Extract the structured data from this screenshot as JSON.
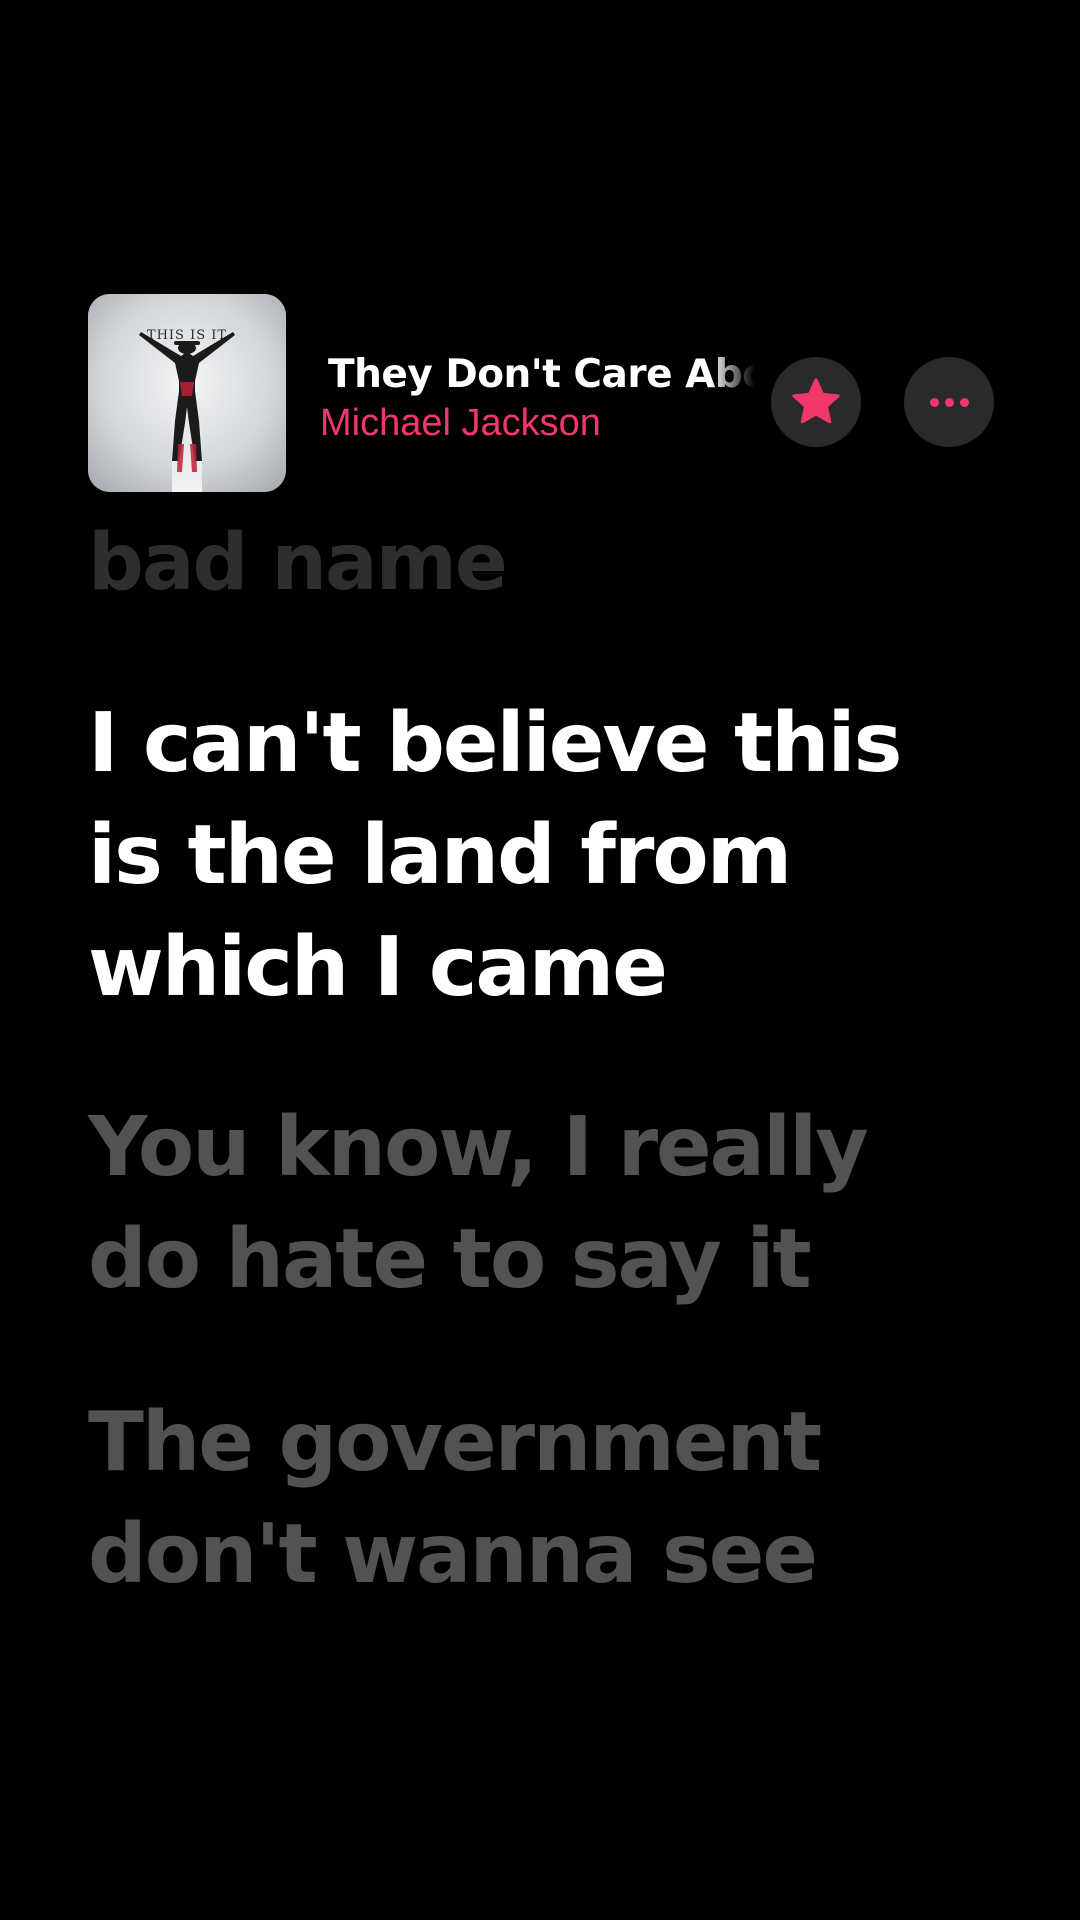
{
  "now_playing": {
    "artwork_text": "THIS IS IT",
    "title": "They Don't Care About Us",
    "artist": "Michael Jackson",
    "accent_color": "#f2376a",
    "favorite_icon": "star-icon",
    "more_icon": "ellipsis-icon"
  },
  "lyrics": {
    "previous": "bad name",
    "current": [
      "I can't believe this",
      "is the land from",
      "which I came"
    ],
    "next_1": [
      "You know, I really",
      "do hate to say it"
    ],
    "next_2": [
      "The government",
      "don't wanna see"
    ]
  }
}
